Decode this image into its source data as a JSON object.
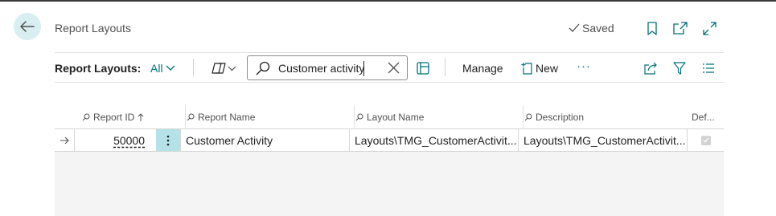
{
  "header": {
    "title": "Report Layouts",
    "saved_label": "Saved",
    "icons": [
      "bookmark-icon",
      "open-new-window-icon",
      "expand-icon"
    ]
  },
  "toolbar": {
    "label": "Report Layouts:",
    "filter_value": "All",
    "search": {
      "value": "Customer activity"
    },
    "manage_label": "Manage",
    "new_label": "New",
    "more_label": "···"
  },
  "columns": {
    "report_id": "Report ID",
    "report_name": "Report Name",
    "layout_name": "Layout Name",
    "description": "Description",
    "default": "Def..."
  },
  "rows": [
    {
      "report_id": "50000",
      "report_name": "Customer Activity",
      "layout_name": "Layouts\\TMG_CustomerActivit...",
      "description": "Layouts\\TMG_CustomerActivit...",
      "default": true
    }
  ],
  "colors": {
    "accent": "#00717a",
    "back_button_bg": "#d8eef0",
    "selected_cell_bg": "#b4e2e8",
    "empty_grid_bg": "#f4f4f5"
  }
}
